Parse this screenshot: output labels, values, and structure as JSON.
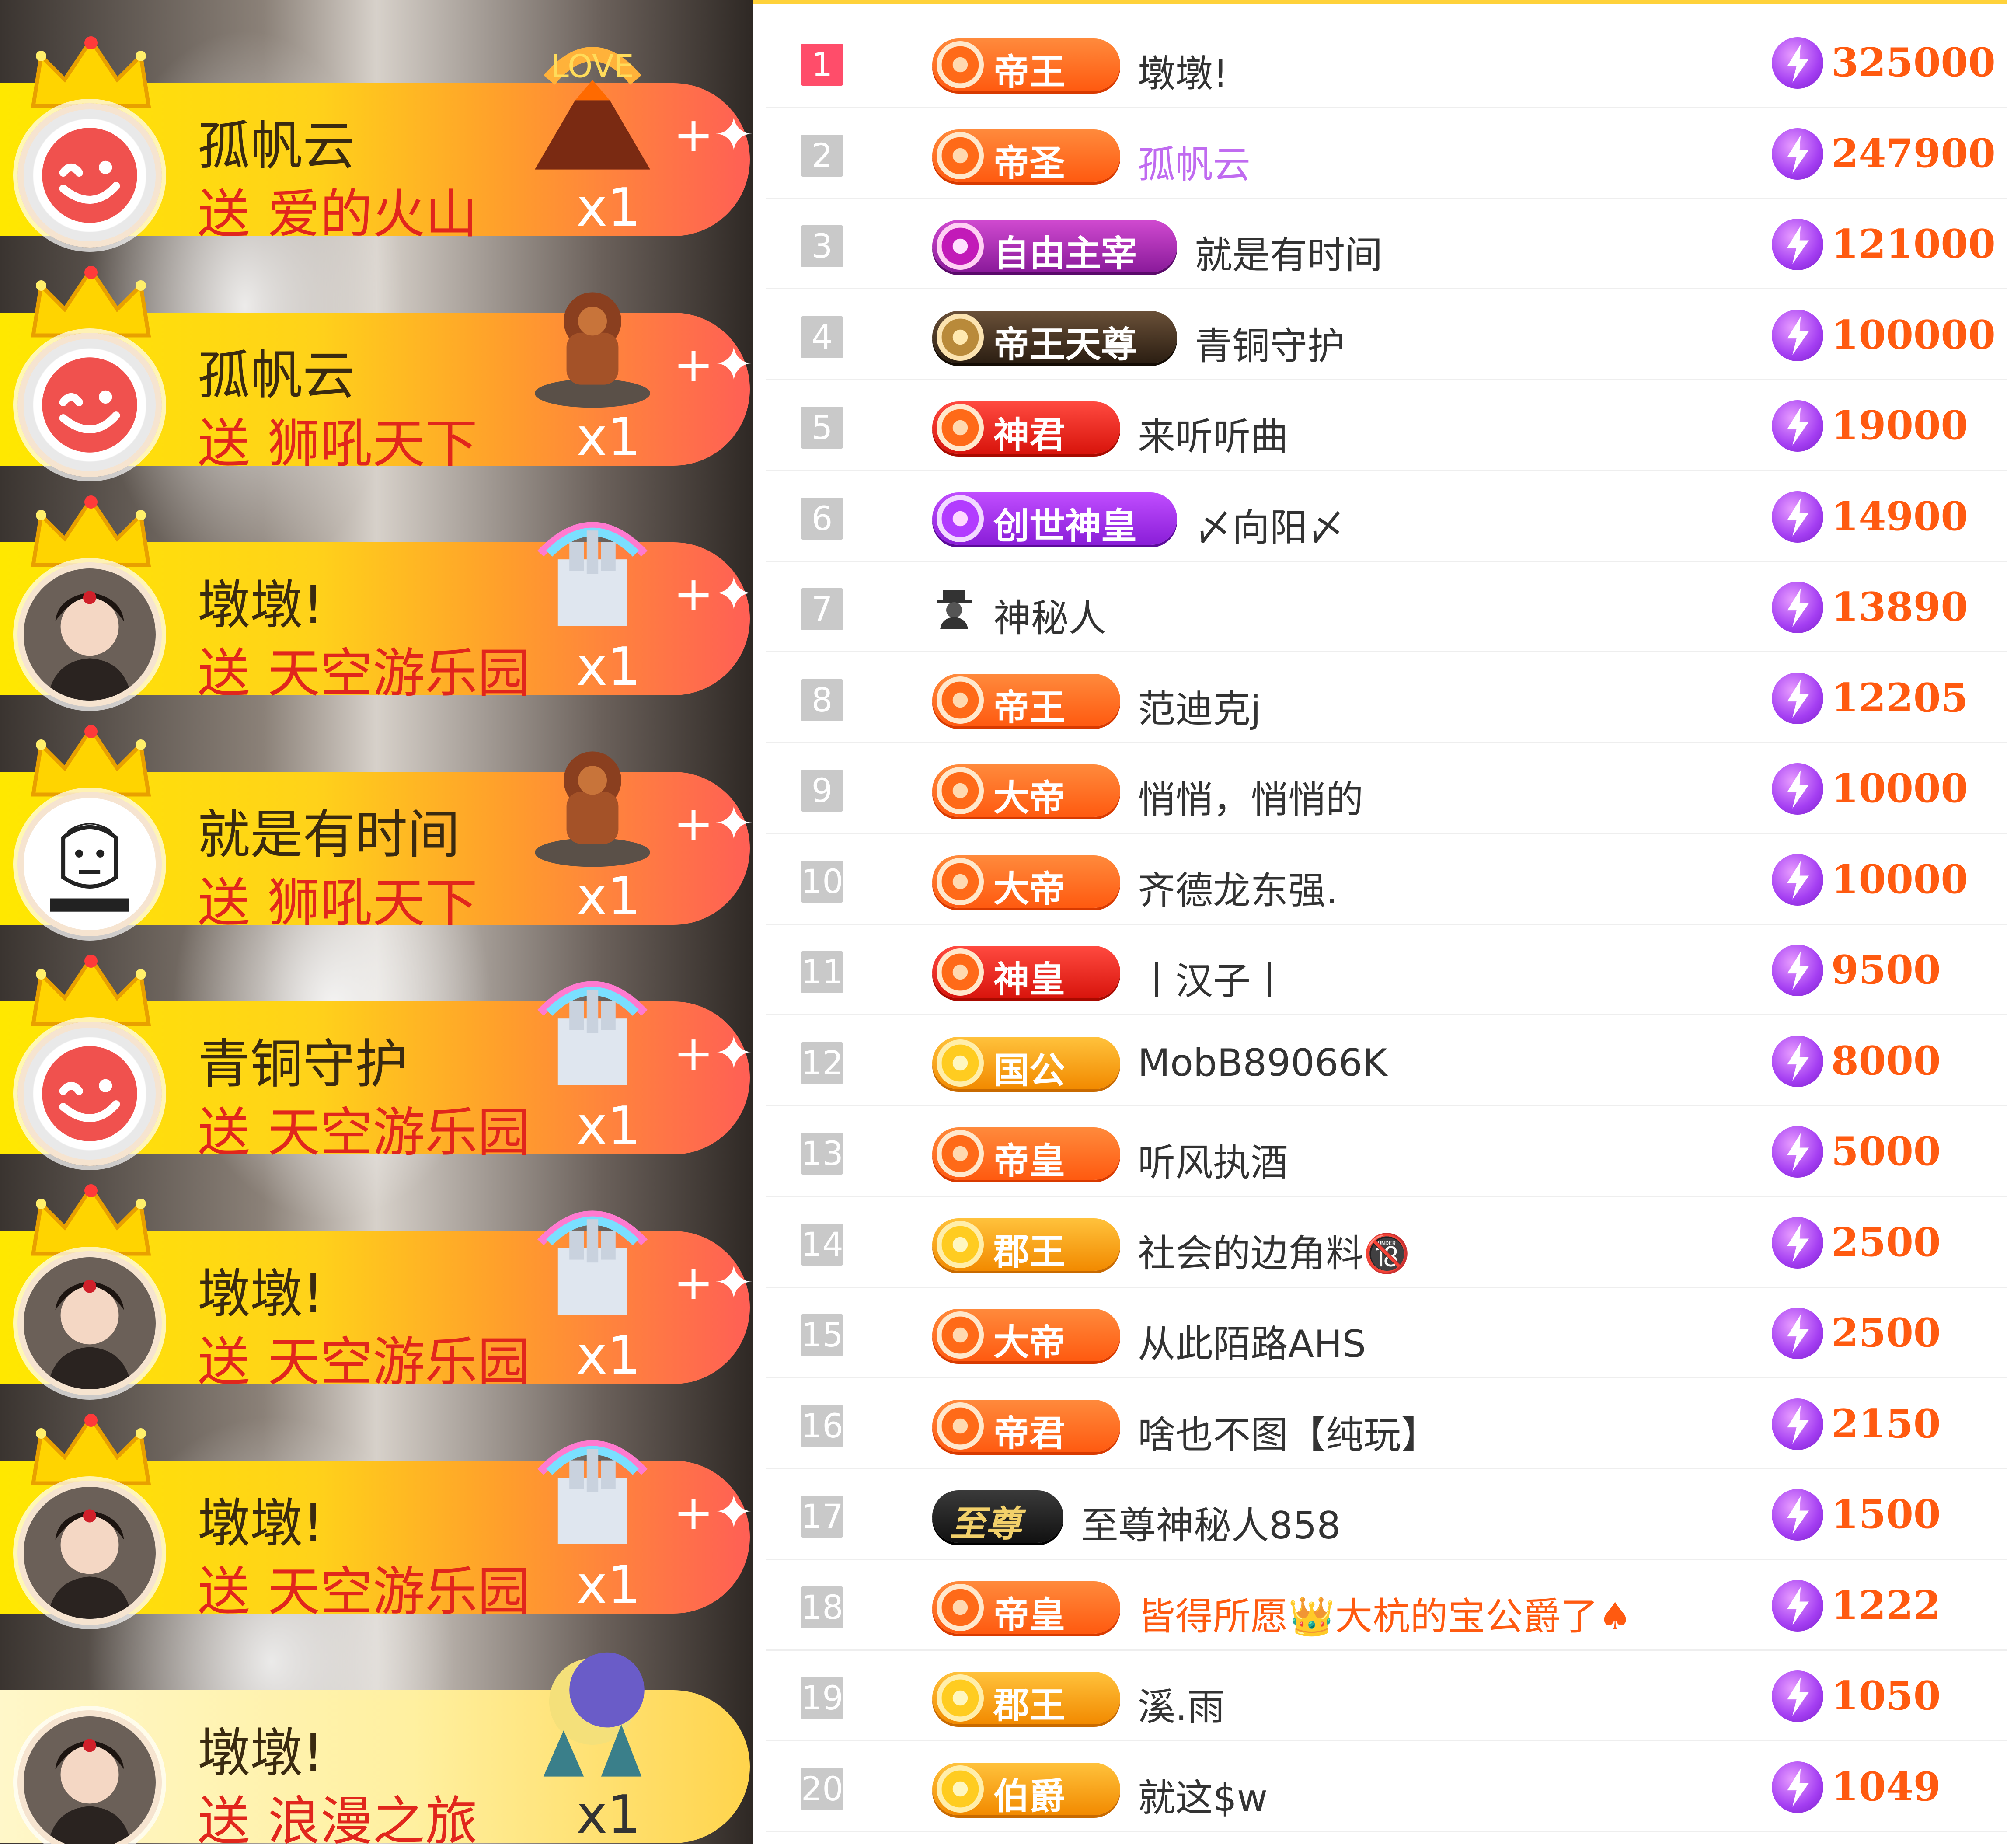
{
  "gift_feed": [
    {
      "sender": "孤帆云",
      "verb": "送",
      "gift": "爱的火山",
      "count": "x1",
      "avatar": "default",
      "gift_icon": "volcano-love-icon"
    },
    {
      "sender": "孤帆云",
      "verb": "送",
      "gift": "狮吼天下",
      "count": "x1",
      "avatar": "default",
      "gift_icon": "lion-icon"
    },
    {
      "sender": "墩墩!",
      "verb": "送",
      "gift": "天空游乐园",
      "count": "x1",
      "avatar": "photo",
      "gift_icon": "sky-castle-icon"
    },
    {
      "sender": "就是有时间",
      "verb": "送",
      "gift": "狮吼天下",
      "count": "x1",
      "avatar": "cartoon",
      "gift_icon": "lion-icon"
    },
    {
      "sender": "青铜守护",
      "verb": "送",
      "gift": "天空游乐园",
      "count": "x1",
      "avatar": "default",
      "gift_icon": "sky-castle-icon"
    },
    {
      "sender": "墩墩!",
      "verb": "送",
      "gift": "天空游乐园",
      "count": "x1",
      "avatar": "photo",
      "gift_icon": "sky-castle-icon"
    },
    {
      "sender": "墩墩!",
      "verb": "送",
      "gift": "天空游乐园",
      "count": "x1",
      "avatar": "photo",
      "gift_icon": "sky-castle-icon"
    },
    {
      "sender": "墩墩!",
      "verb": "送",
      "gift": "浪漫之旅",
      "count": "x1",
      "avatar": "photo",
      "gift_icon": "moon-journey-icon"
    }
  ],
  "ranking": [
    {
      "rank": "1",
      "badge": "帝王",
      "badge_style": "orange",
      "name": "墩墩!",
      "score": "325000"
    },
    {
      "rank": "2",
      "badge": "帝圣",
      "badge_style": "orange",
      "name": "孤帆云",
      "name_style": "purple",
      "score": "247900"
    },
    {
      "rank": "3",
      "badge": "自由主宰",
      "badge_style": "magenta",
      "name": "就是有时间",
      "score": "121000"
    },
    {
      "rank": "4",
      "badge": "帝王天尊",
      "badge_style": "dark",
      "name": "青铜守护",
      "score": "100000"
    },
    {
      "rank": "5",
      "badge": "神君",
      "badge_style": "red",
      "name": "来听听曲",
      "score": "19000"
    },
    {
      "rank": "6",
      "badge": "创世神皇",
      "badge_style": "purple",
      "name": "〆向阳〆",
      "score": "14900"
    },
    {
      "rank": "7",
      "badge": "",
      "badge_style": "mystery",
      "name": "神秘人",
      "score": "13890"
    },
    {
      "rank": "8",
      "badge": "帝王",
      "badge_style": "orange",
      "name": "范迪克j",
      "score": "12205"
    },
    {
      "rank": "9",
      "badge": "大帝",
      "badge_style": "orange",
      "name": "悄悄，悄悄的",
      "score": "10000"
    },
    {
      "rank": "10",
      "badge": "大帝",
      "badge_style": "orange",
      "name": "齐德龙东强.",
      "score": "10000"
    },
    {
      "rank": "11",
      "badge": "神皇",
      "badge_style": "red",
      "name": "丨汉子丨",
      "score": "9500"
    },
    {
      "rank": "12",
      "badge": "国公",
      "badge_style": "gold",
      "name": "MobB89066K",
      "score": "8000"
    },
    {
      "rank": "13",
      "badge": "帝皇",
      "badge_style": "orange",
      "name": "听风执酒",
      "score": "5000"
    },
    {
      "rank": "14",
      "badge": "郡王",
      "badge_style": "gold",
      "name": "社会的边角料🔞",
      "score": "2500"
    },
    {
      "rank": "15",
      "badge": "大帝",
      "badge_style": "orange",
      "name": "从此陌路AHS",
      "score": "2500"
    },
    {
      "rank": "16",
      "badge": "帝君",
      "badge_style": "orange",
      "name": "啥也不图【纯玩】",
      "score": "2150"
    },
    {
      "rank": "17",
      "badge": "至尊",
      "badge_style": "black",
      "name": "至尊神秘人858",
      "score": "1500"
    },
    {
      "rank": "18",
      "badge": "帝皇",
      "badge_style": "orange",
      "name": "皆得所愿👑大杭的宝公爵了♠",
      "name_style": "orange",
      "score": "1222"
    },
    {
      "rank": "19",
      "badge": "郡王",
      "badge_style": "gold",
      "name": "溪.雨",
      "score": "1050"
    },
    {
      "rank": "20",
      "badge": "伯爵",
      "badge_style": "gold",
      "name": "就这$w",
      "score": "1049"
    }
  ],
  "colors": {
    "gift_bar_start": "#ffe800",
    "gift_bar_end": "#ff5f55",
    "gift_text": "#e1261c",
    "rank_first": "#ff4d6a",
    "score": "#ff5a10",
    "coin": "#a43ef2"
  }
}
